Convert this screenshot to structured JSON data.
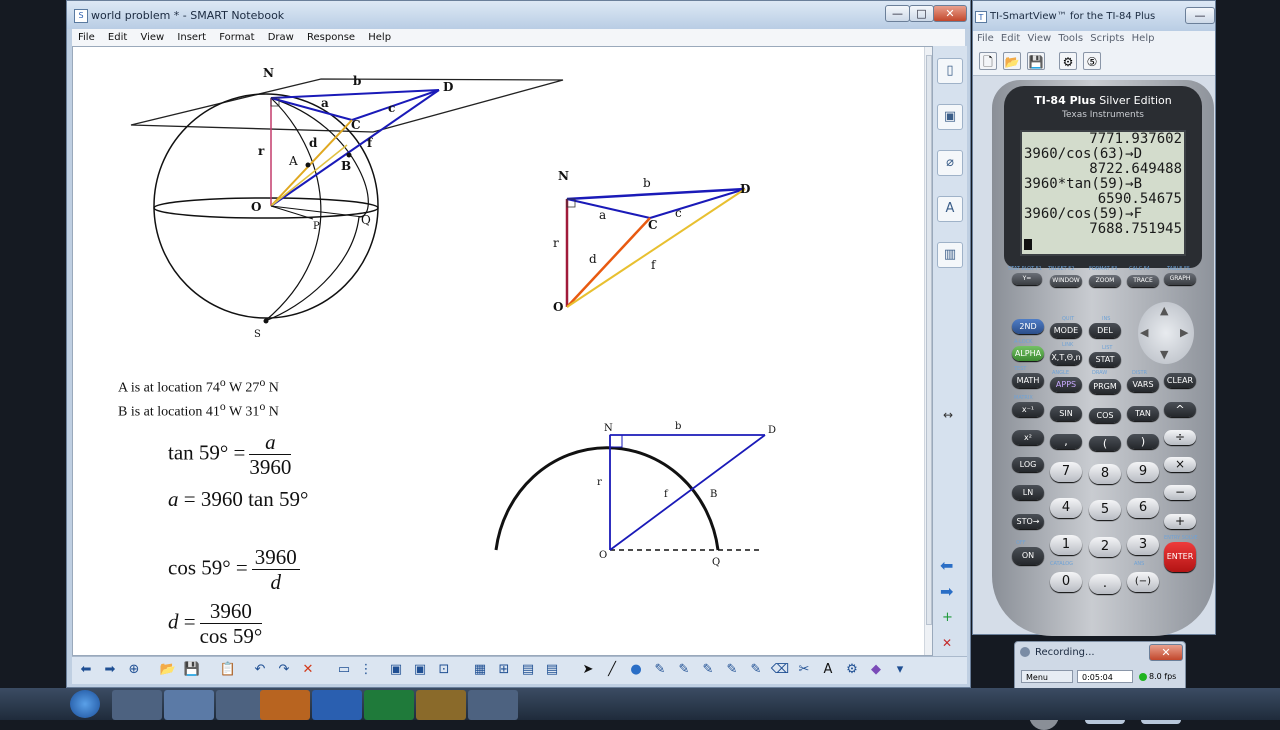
{
  "smart_notebook": {
    "title": "world problem * - SMART Notebook",
    "controls": {
      "minimize": "—",
      "maximize": "□",
      "close": "✕"
    },
    "menu": [
      "File",
      "Edit",
      "View",
      "Insert",
      "Format",
      "Draw",
      "Response",
      "Help"
    ],
    "page": {
      "sphere_labels": {
        "N": "N",
        "b": "b",
        "D": "D",
        "a": "a",
        "c": "c",
        "C": "C",
        "r": "r",
        "A": "A",
        "d": "d",
        "f": "f",
        "B": "B",
        "O": "O",
        "P": "P",
        "Q": "Q",
        "S": "S"
      },
      "triangle_labels": {
        "N": "N",
        "b": "b",
        "D": "D",
        "a": "a",
        "C": "C",
        "c": "c",
        "r": "r",
        "d": "d",
        "f": "f",
        "O": "O"
      },
      "circle_labels": {
        "N": "N",
        "b": "b",
        "D": "D",
        "r": "r",
        "f": "f",
        "B": "B",
        "O": "O",
        "Q": "Q"
      },
      "location_a": {
        "prefix": "A is at location 74",
        "deg1": "o",
        "mid": " W 27",
        "deg2": "o",
        "suffix": " N"
      },
      "location_b": {
        "prefix": "B is at location 41",
        "deg1": "o",
        "mid": " W 31",
        "deg2": "o",
        "suffix": " N"
      },
      "eq1": {
        "lhs": "tan 59° =",
        "num": "a",
        "den": "3960"
      },
      "eq2": {
        "var": "a",
        "rhs": " = 3960 tan 59°"
      },
      "eq3": {
        "lhs": "cos 59° =",
        "num": "3960",
        "den": "d"
      },
      "eq4": {
        "var": "d",
        "eq": " =",
        "num": "3960",
        "den": "cos 59°"
      }
    },
    "side_tabs": [
      "page-sorter",
      "gallery",
      "attachments",
      "properties",
      "add-ons",
      "resize"
    ],
    "side_nav": {
      "resize": "↔",
      "back": "⬅",
      "forward": "➡",
      "add": "+",
      "delete": "✕"
    },
    "toolbar": [
      "⬅",
      "➡",
      "⊕",
      "📂",
      "💾",
      "📋",
      "↶",
      "↷",
      "✕",
      "▭",
      "⋮",
      "▣",
      "▣",
      "⊡",
      "▦",
      "⊞",
      "▤",
      "▤",
      "➤",
      "╱",
      "●",
      "✎",
      "✎",
      "✎",
      "✎",
      "✎",
      "⌫",
      "✂",
      "A",
      "⚙",
      "◆",
      "▾"
    ]
  },
  "ti_smartview": {
    "title": "TI-SmartView™ for the TI-84 Plus",
    "controls": {
      "minimize": "—",
      "maximize": "□",
      "close": "✕"
    },
    "menu": [
      "File",
      "Edit",
      "View",
      "Tools",
      "Scripts",
      "Help"
    ],
    "toolbar": [
      "🗋",
      "📂",
      "💾",
      "⚙",
      "⑤"
    ],
    "calculator": {
      "model": "TI-84 Plus",
      "edition": " Silver Edition",
      "brand": "Texas Instruments",
      "screen": [
        {
          "text": "7771.937602",
          "align": "right"
        },
        {
          "text": "3960/cos(63)→D",
          "align": "left"
        },
        {
          "text": "8722.649488",
          "align": "right"
        },
        {
          "text": "3960*tan(59)→B",
          "align": "left"
        },
        {
          "text": "6590.54675",
          "align": "right"
        },
        {
          "text": "3960/cos(59)→F",
          "align": "left"
        },
        {
          "text": "7688.751945",
          "align": "right"
        }
      ],
      "fn_keys": [
        "Y=",
        "WINDOW",
        "ZOOM",
        "TRACE",
        "GRAPH"
      ],
      "fn_labels": [
        "STAT PLOT F1",
        "TBLSET F2",
        "FORMAT F3",
        "CALC F4",
        "TABLE F5"
      ],
      "keys": {
        "second": "2ND",
        "mode": "MODE",
        "del": "DEL",
        "alpha": "ALPHA",
        "xton": "X,T,Θ,n",
        "stat": "STAT",
        "math": "MATH",
        "apps": "APPS",
        "prgm": "PRGM",
        "vars": "VARS",
        "clear": "CLEAR",
        "inv": "x⁻¹",
        "sin": "SIN",
        "cos": "COS",
        "tan": "TAN",
        "pow": "^",
        "sq": "x²",
        "comma": ",",
        "lparen": "(",
        "rparen": ")",
        "div": "÷",
        "log": "LOG",
        "k7": "7",
        "k8": "8",
        "k9": "9",
        "mul": "×",
        "ln": "LN",
        "k4": "4",
        "k5": "5",
        "k6": "6",
        "sub": "−",
        "sto": "STO→",
        "k1": "1",
        "k2": "2",
        "k3": "3",
        "add": "+",
        "on": "ON",
        "k0": "0",
        "dot": ".",
        "neg": "(−)",
        "enter": "ENTER"
      },
      "sub_labels": {
        "quit": "QUIT",
        "ins": "INS",
        "alock": "A-LOCK",
        "link": "LINK",
        "list": "LIST",
        "test": "TEST",
        "angle": "ANGLE",
        "draw": "DRAW",
        "distr": "DISTR",
        "matrix": "MATRIX",
        "off": "OFF",
        "catalog": "CATALOG",
        "ans": "ANS",
        "entry": "ENTRY SOLVE"
      }
    }
  },
  "recording": {
    "title": "Recording...",
    "menu": "Menu",
    "time": "0:05:04",
    "fps": "8.0 fps",
    "close": "✕"
  },
  "taskbar": [
    "start",
    "explorer",
    "smart-notebook",
    "ti-smartview",
    "firefox",
    "word",
    "excel",
    "geometry",
    "recorder"
  ]
}
